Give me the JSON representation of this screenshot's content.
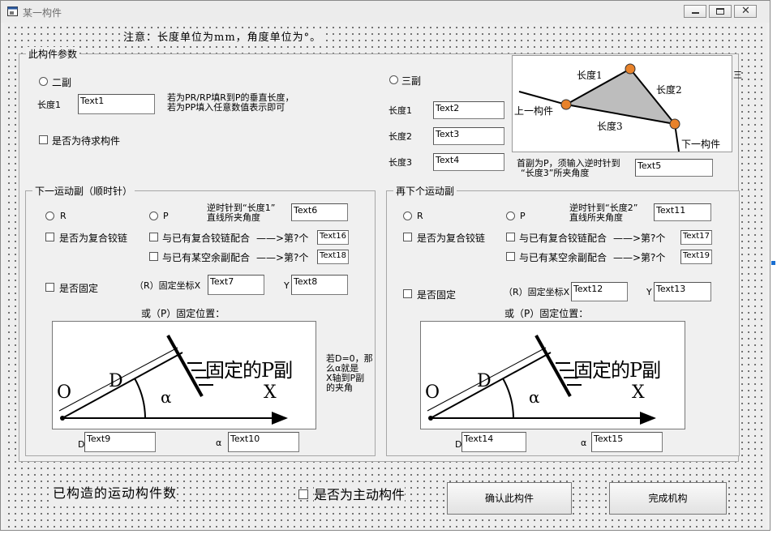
{
  "window": {
    "title": "某一构件"
  },
  "notice": "注意：长度单位为mm，角度单位为°。",
  "params": {
    "frame_label": "此构件参数",
    "binary_radio": "二副",
    "length1_label": "长度1",
    "length1_value": "Text1",
    "binary_note_line1": "若为PR/RP填R到P的垂直长度，",
    "binary_note_line2": "若为PP填入任意数值表示即可",
    "pending_check": "是否为待求构件",
    "ternary_radio": "三副",
    "t_length1_label": "长度1",
    "t_length1_value": "Text2",
    "t_length2_label": "长度2",
    "t_length2_value": "Text3",
    "t_length3_label": "长度3",
    "t_length3_value": "Text4",
    "triangle": {
      "length1": "长度1",
      "length2": "长度2",
      "length3": "长度3",
      "prev": "上一构件",
      "next": "下一构件"
    },
    "p_note_line1": "首副为P，须输入逆时针到",
    "p_note_line2": "“长度3”所夹角度",
    "p_note_value": "Text5",
    "edge_char": "三"
  },
  "next_pair": {
    "frame_label": "下一运动副（顺时针）",
    "r_radio": "R",
    "p_radio": "P",
    "angle_note_line1": "逆时针到“长度1”",
    "angle_note_line2": "直线所夹角度",
    "angle_value": "Text6",
    "compound_check": "是否为复合铰链",
    "match_compound_check": "与已有复合铰链配合",
    "match_compound_arrow": "——>第?个",
    "match_compound_value": "Text16",
    "match_slot_check": "与已有某空余副配合",
    "match_slot_arrow": "——>第?个",
    "match_slot_value": "Text18",
    "fixed_check": "是否固定",
    "fixed_x_label": "（R）固定坐标X",
    "fixed_x_value": "Text7",
    "y_label": "Y",
    "fixed_y_value": "Text8",
    "p_position_label": "或（P）固定位置：",
    "diagram": {
      "title": "固定的P副",
      "o": "O",
      "d": "D",
      "alpha": "α",
      "x": "X"
    },
    "d_label": "D",
    "d_value": "Text9",
    "alpha_label": "α",
    "alpha_value": "Text10",
    "side_note": [
      "若D=0，那",
      "么α就是",
      "X轴到P副",
      "的夹角"
    ]
  },
  "after_pair": {
    "frame_label": "再下个运动副",
    "r_radio": "R",
    "p_radio": "P",
    "angle_note_line1": "逆时针到“长度2”",
    "angle_note_line2": "直线所夹角度",
    "angle_value": "Text11",
    "compound_check": "是否为复合铰链",
    "match_compound_check": "与已有复合铰链配合",
    "match_compound_arrow": "——>第?个",
    "match_compound_value": "Text17",
    "match_slot_check": "与已有某空余副配合",
    "match_slot_arrow": "——>第?个",
    "match_slot_value": "Text19",
    "fixed_check": "是否固定",
    "fixed_x_label": "（R）固定坐标X",
    "fixed_x_value": "Text12",
    "y_label": "Y",
    "fixed_y_value": "Text13",
    "p_position_label": "或（P）固定位置：",
    "diagram": {
      "title": "固定的P副",
      "o": "O",
      "d": "D",
      "alpha": "α",
      "x": "X"
    },
    "d_label": "D",
    "d_value": "Text14",
    "alpha_label": "α",
    "alpha_value": "Text15"
  },
  "footer": {
    "built_count_label": "已构造的运动构件数",
    "driver_check": "是否为主动构件",
    "confirm_button": "确认此构件",
    "finish_button": "完成机构"
  },
  "colors": {
    "joint": "#e8822a",
    "triangle_fill": "#bdbdbd",
    "accent_dot": "#1a6fd1"
  }
}
